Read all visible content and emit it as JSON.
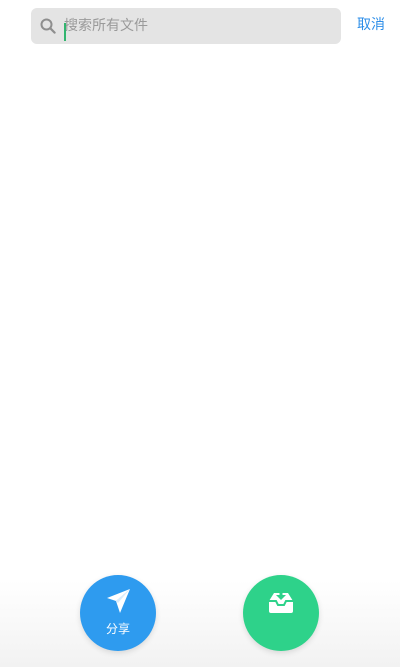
{
  "search": {
    "placeholder": "搜索所有文件",
    "value": ""
  },
  "header": {
    "cancel_label": "取消"
  },
  "actions": {
    "share_label": "分享",
    "receive_label": ""
  },
  "icons": {
    "search": "search-icon",
    "share": "paper-plane-icon",
    "receive": "inbox-download-icon"
  },
  "colors": {
    "accent": "#2d8ee8",
    "share_button": "#2e9bef",
    "receive_button": "#2ed28a",
    "search_background": "#e4e4e4",
    "caret": "#32b56f"
  }
}
